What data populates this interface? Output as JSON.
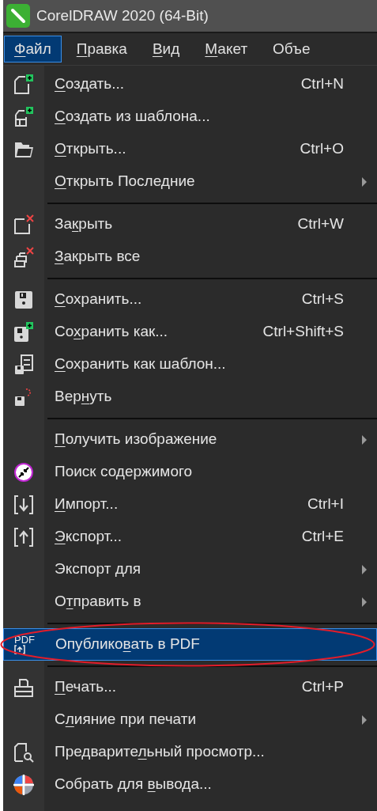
{
  "window": {
    "title": "CorelDRAW 2020 (64-Bit)"
  },
  "menu_bar": [
    {
      "key": "Ф",
      "post": "айл",
      "selected": true
    },
    {
      "key": "П",
      "post": "равка",
      "selected": false
    },
    {
      "key": "В",
      "post": "ид",
      "selected": false
    },
    {
      "key": "М",
      "post": "акет",
      "selected": false
    },
    {
      "pre": "Объе",
      "selected": false
    }
  ],
  "menu": {
    "groups": [
      [
        {
          "key": "С",
          "post": "оздать...",
          "shortcut": "Ctrl+N",
          "submenu": false,
          "selected": false
        },
        {
          "key": "С",
          "post": "оздать из шаблона...",
          "submenu": false,
          "selected": false
        },
        {
          "key": "О",
          "post": "ткрыть...",
          "shortcut": "Ctrl+O",
          "submenu": false,
          "selected": false
        },
        {
          "key": "О",
          "post": "ткрыть Последние",
          "submenu": true,
          "selected": false
        }
      ],
      [
        {
          "pre": "За",
          "key": "к",
          "post": "рыть",
          "shortcut": "Ctrl+W",
          "submenu": false,
          "selected": false
        },
        {
          "key": "З",
          "post": "акрыть все",
          "submenu": false,
          "selected": false
        }
      ],
      [
        {
          "key": "С",
          "post": "охранить...",
          "shortcut": "Ctrl+S",
          "submenu": false,
          "selected": false
        },
        {
          "pre": "Со",
          "key": "х",
          "post": "ранить как...",
          "shortcut": "Ctrl+Shift+S",
          "submenu": false,
          "selected": false
        },
        {
          "key": "С",
          "post": "охранить как шаблон...",
          "submenu": false,
          "selected": false
        },
        {
          "pre": "Вер",
          "key": "н",
          "post": "уть",
          "submenu": false,
          "selected": false
        }
      ],
      [
        {
          "key": "П",
          "post": "олучить изображение",
          "submenu": true,
          "selected": false
        },
        {
          "pre": "Поиск содержимого",
          "submenu": false,
          "selected": false
        },
        {
          "key": "И",
          "post": "мпорт...",
          "shortcut": "Ctrl+I",
          "submenu": false,
          "selected": false
        },
        {
          "key": "Э",
          "post": "кспорт...",
          "shortcut": "Ctrl+E",
          "submenu": false,
          "selected": false
        },
        {
          "pre": "Экспорт ",
          "key": "д",
          "post": "ля",
          "submenu": true,
          "selected": false
        },
        {
          "pre": "О",
          "key": "т",
          "post": "править в",
          "submenu": true,
          "selected": false
        }
      ],
      [
        {
          "icon_text": "PDF",
          "pre": "Опублико",
          "key": "в",
          "post": "ать в PDF",
          "submenu": false,
          "selected": true,
          "circled": true
        }
      ],
      [
        {
          "key": "П",
          "post": "ечать...",
          "shortcut": "Ctrl+P",
          "submenu": false,
          "selected": false
        },
        {
          "pre": "С",
          "key": "л",
          "post": "ияние при печати",
          "submenu": true,
          "selected": false
        },
        {
          "pre": "Предварите",
          "key": "л",
          "post": "ьный просмотр...",
          "submenu": false,
          "selected": false
        },
        {
          "pre": "Собрать для ",
          "key": "в",
          "post": "ывода...",
          "submenu": false,
          "selected": false
        }
      ]
    ]
  }
}
